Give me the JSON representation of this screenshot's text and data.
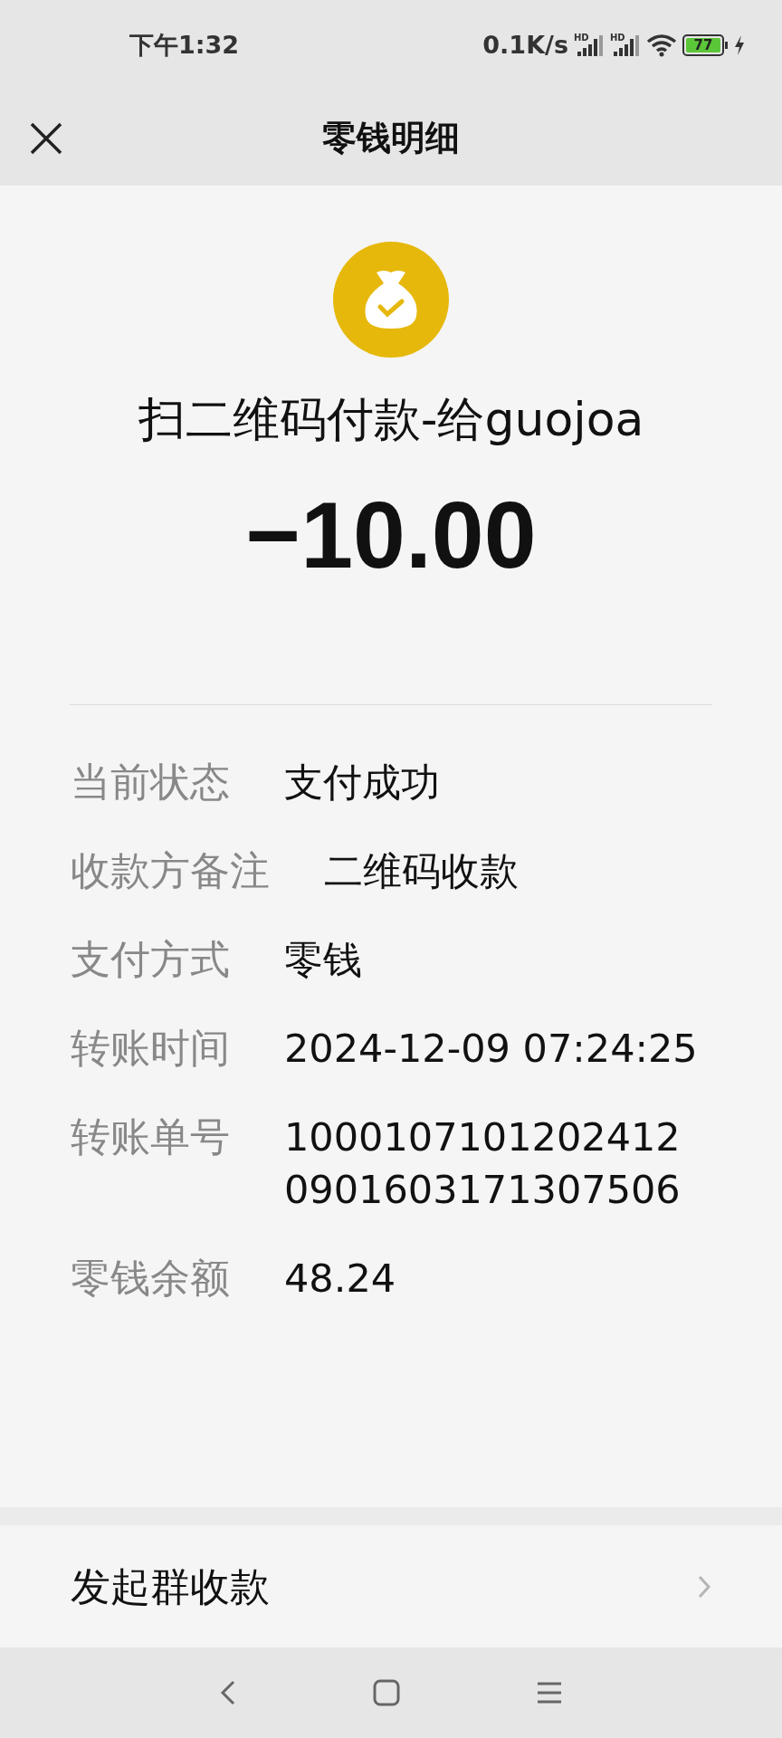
{
  "status_bar": {
    "time": "下午1:32",
    "speed": "0.1K/s",
    "signal_labels": [
      "HD",
      "HD"
    ],
    "battery": "77"
  },
  "header": {
    "title": "零钱明细"
  },
  "summary": {
    "title": "扫二维码付款-给guojoa",
    "amount": "−10.00"
  },
  "details": [
    {
      "label": "当前状态",
      "value": "支付成功"
    },
    {
      "label": "收款方备注",
      "value": "二维码收款"
    },
    {
      "label": "支付方式",
      "value": "零钱"
    },
    {
      "label": "转账时间",
      "value": "2024-12-09 07:24:25"
    },
    {
      "label": "转账单号",
      "value": "10001071012024120901603171307506"
    },
    {
      "label": "零钱余额",
      "value": "48.24"
    }
  ],
  "actions": [
    {
      "label": "发起群收款"
    }
  ]
}
